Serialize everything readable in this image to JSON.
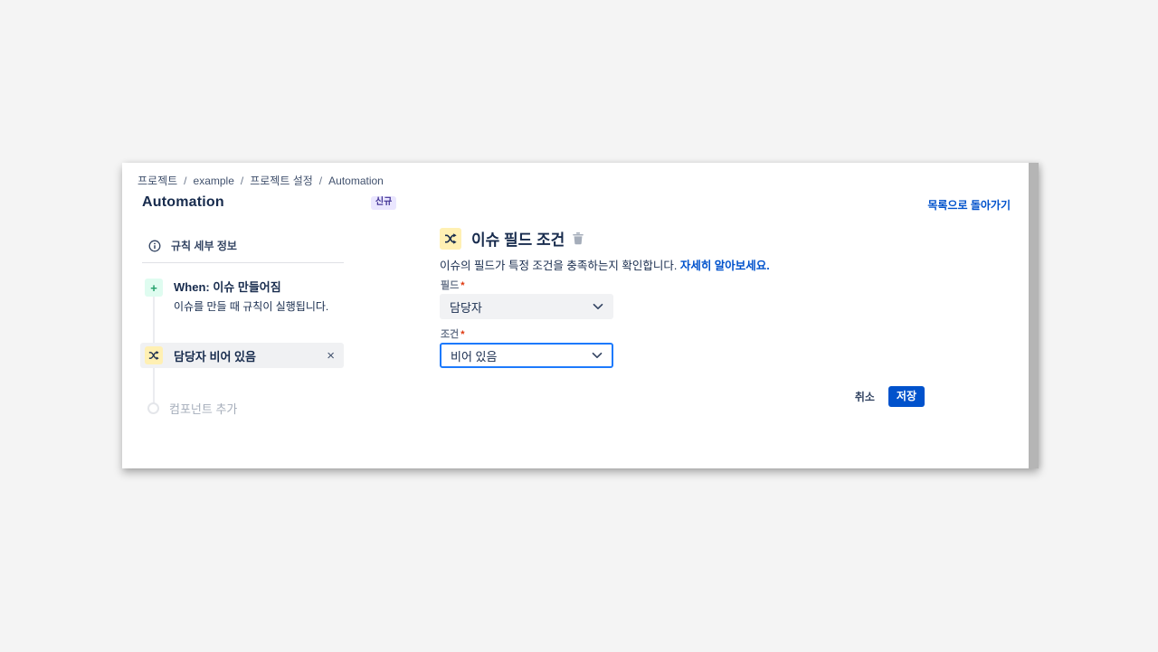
{
  "breadcrumb": {
    "separator": "/",
    "items": [
      "프로젝트",
      "example",
      "프로젝트 설정",
      "Automation"
    ]
  },
  "header": {
    "title": "Automation",
    "badge": "신규",
    "back_link": "목록으로 돌아가기"
  },
  "sidebar": {
    "rule_details_label": "규칙 세부 정보",
    "trigger": {
      "label": "When: 이슈 만들어짐",
      "description": "이슈를 만들 때 규칙이 실행됩니다."
    },
    "condition_item": {
      "label": "담당자 비어 있음",
      "close_glyph": "×"
    },
    "add_component_label": "컴포넌트 추가"
  },
  "main": {
    "heading": "이슈 필드 조건",
    "description": "이슈의 필드가 특정 조건을 충족하는지 확인합니다.",
    "learn_more": "자세히 알아보세요.",
    "field": {
      "label": "필드",
      "required": "*",
      "value": "담당자"
    },
    "condition": {
      "label": "조건",
      "required": "*",
      "value": "비어 있음"
    },
    "cancel_label": "취소",
    "save_label": "저장"
  },
  "icons": {
    "plus_glyph": "+"
  },
  "colors": {
    "accent_blue": "#0052cc",
    "focus_border": "#1d7afc",
    "badge_bg": "#eae6ff",
    "badge_text": "#403294",
    "trigger_icon_bg": "#dffcf0",
    "trigger_icon_fg": "#22a06b",
    "condition_icon_bg": "#fff0b3",
    "required_red": "#de350b"
  }
}
